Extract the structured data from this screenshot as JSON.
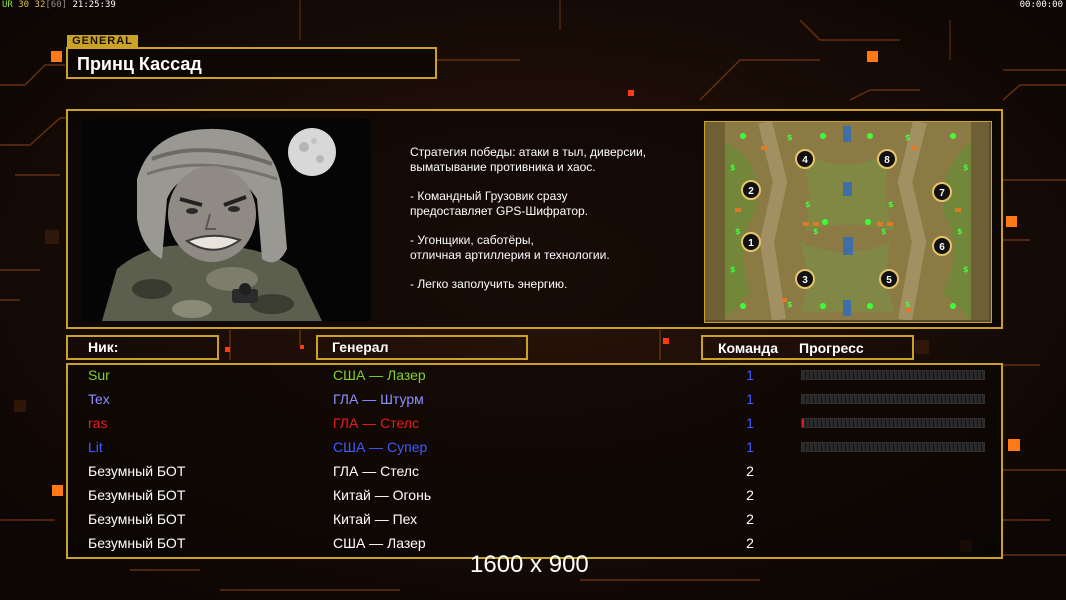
{
  "hud": {
    "fps_label": "UR",
    "fps_a": "30",
    "fps_b": "32",
    "fps_c": "[60]",
    "time_left": "21:25:39",
    "time_right": "00:00:00"
  },
  "general": {
    "tag": "GENERAL",
    "name": "Принц Кассад"
  },
  "description": [
    "Стратегия победы: атаки в тыл, диверсии,\n выматывание противника и хаос.",
    "- Командный Грузовик сразу\nпредоставляет GPS-Шифратор.",
    "- Угонщики, саботёры,\nотличная артиллерия и технологии.",
    "- Легко заполучить энергию."
  ],
  "minimap": {
    "start_positions": [
      "1",
      "2",
      "3",
      "4",
      "5",
      "6",
      "7",
      "8"
    ],
    "ground_color": "#8c7a45",
    "grass_color": "#6f8a3a",
    "water_color": "#3f6fa6"
  },
  "headers": {
    "nick": "Ник:",
    "general": "Генерал",
    "team": "Команда",
    "progress": "Прогресс"
  },
  "players": [
    {
      "nick": "Sur",
      "general": "США — Лазер",
      "team": "1",
      "color": "#7fd12e",
      "progress": 0.0,
      "show_bar": true
    },
    {
      "nick": "Tex",
      "general": "ГЛА — Штурм",
      "team": "1",
      "color": "#8f8fff",
      "progress": 0.0,
      "show_bar": true
    },
    {
      "nick": "ras",
      "general": "ГЛА — Стелс",
      "team": "1",
      "color": "#ee1b1b",
      "progress": 0.01,
      "show_bar": true
    },
    {
      "nick": "Lit",
      "general": "США — Супер",
      "team": "1",
      "color": "#3f5bff",
      "progress": 0.0,
      "show_bar": true
    },
    {
      "nick": "Безумный БОТ",
      "general": "ГЛА — Стелс",
      "team": "2",
      "color": "#ffffff",
      "progress": 0.0,
      "show_bar": false
    },
    {
      "nick": "Безумный БОТ",
      "general": "Китай — Огонь",
      "team": "2",
      "color": "#ffffff",
      "progress": 0.0,
      "show_bar": false
    },
    {
      "nick": "Безумный БОТ",
      "general": "Китай — Пех",
      "team": "2",
      "color": "#ffffff",
      "progress": 0.0,
      "show_bar": false
    },
    {
      "nick": "Безумный БОТ",
      "general": "США — Лазер",
      "team": "2",
      "color": "#ffffff",
      "progress": 0.0,
      "show_bar": false
    }
  ],
  "team_number_color": "#3f5bff",
  "resolution_text": "1600 x 900",
  "colors": {
    "accent": "#c9a227",
    "background": "#120a06",
    "hud_green": "#8ee03a",
    "hud_yellow": "#e0c24a"
  }
}
